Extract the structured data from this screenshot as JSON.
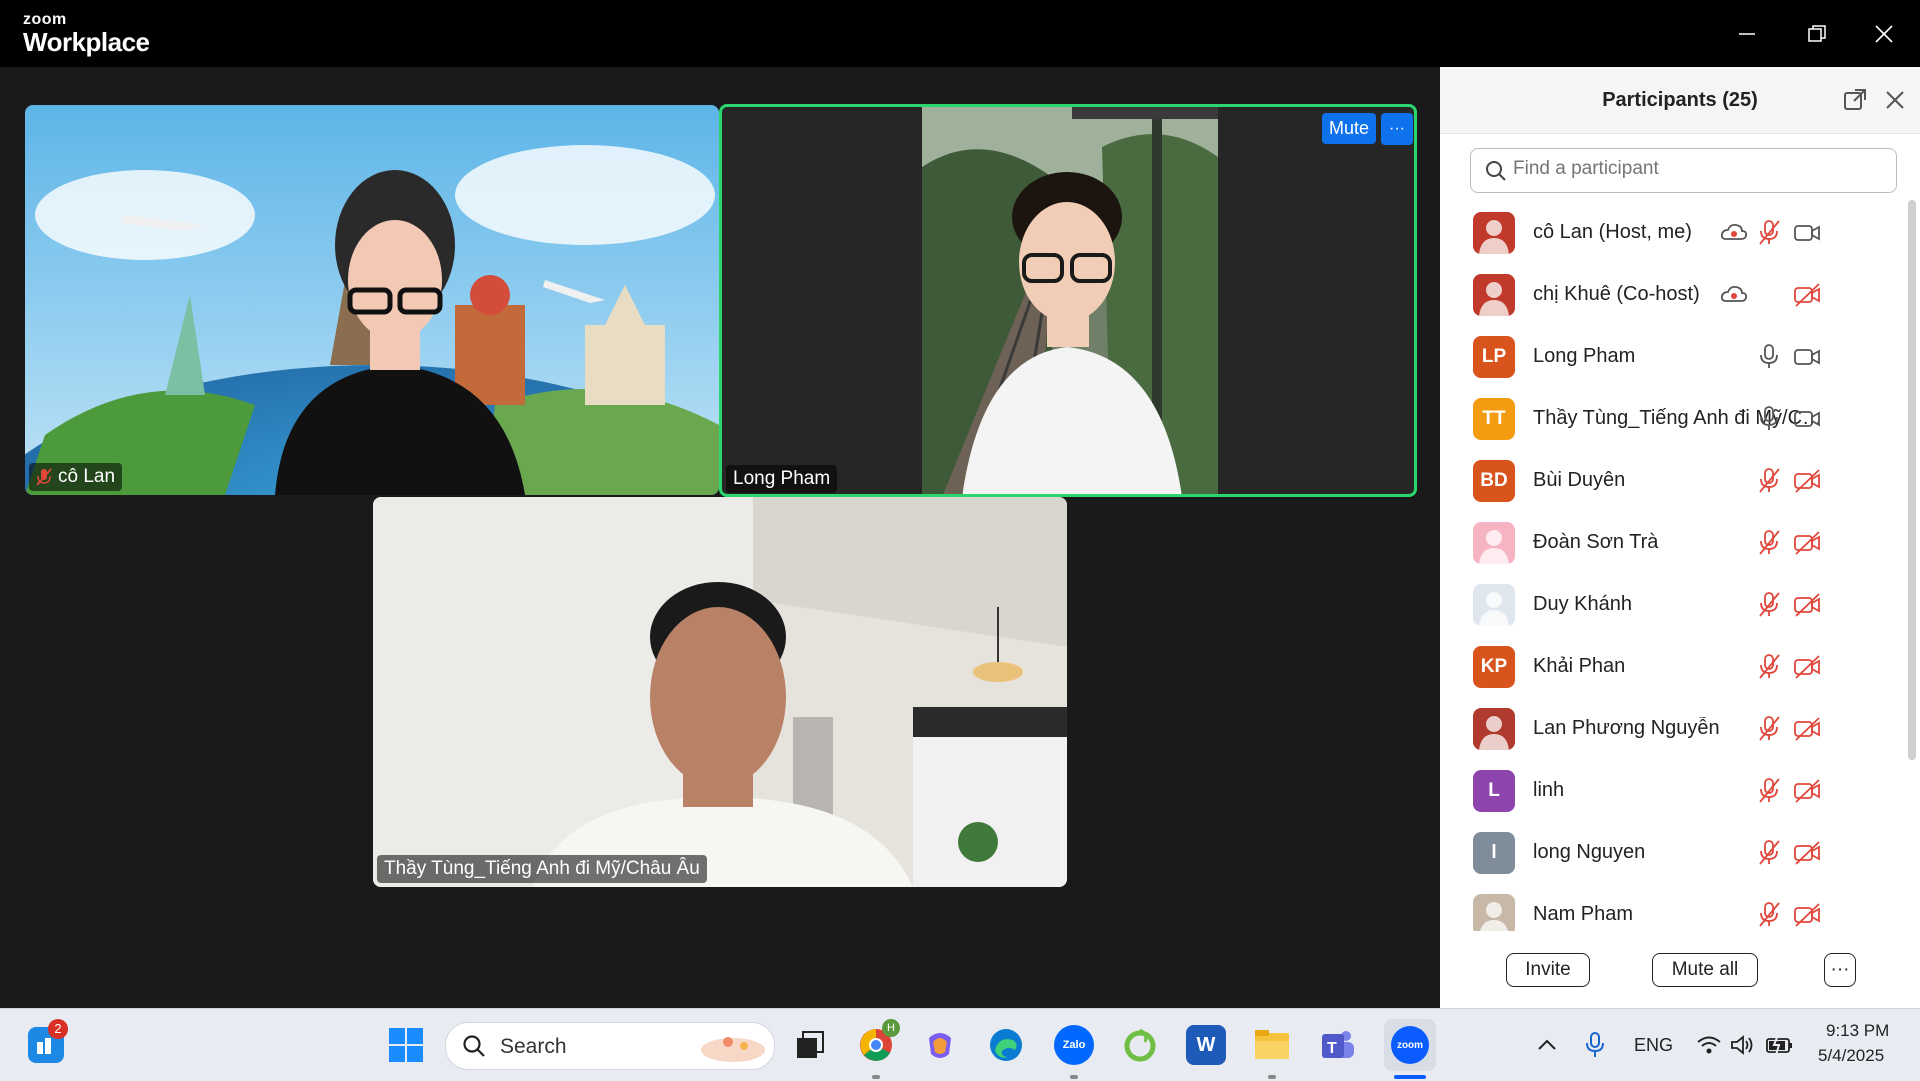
{
  "app": {
    "brand_small": "zoom",
    "brand_big": "Workplace"
  },
  "window_controls": {
    "minimize": "minimize-icon",
    "restore": "restore-icon",
    "close": "close-icon"
  },
  "videos": [
    {
      "name": "cô Lan",
      "muted": true
    },
    {
      "name": "Long Pham",
      "active_speaker": true,
      "mute_label": "Mute",
      "more_label": "···"
    },
    {
      "name": "Thầy Tùng_Tiếng Anh đi Mỹ/Châu Âu"
    }
  ],
  "participants_panel": {
    "title": "Participants (25)",
    "search_placeholder": "Find a participant",
    "participants": [
      {
        "name": "cô Lan (Host, me)",
        "avatar_type": "photo",
        "avatar_color": "#c0392b",
        "cloud": true,
        "mic": "muted",
        "video": "on"
      },
      {
        "name": "chị Khuê (Co-host)",
        "avatar_type": "photo",
        "avatar_color": "#c0392b",
        "cloud": true,
        "mic": "none",
        "video": "off"
      },
      {
        "name": "Long Pham",
        "initials": "LP",
        "avatar_color": "#d8541c",
        "mic": "on",
        "video": "on"
      },
      {
        "name": "Thầy Tùng_Tiếng Anh đi Mỹ/Ch...",
        "initials": "TT",
        "avatar_color": "#f39c12",
        "mic": "on",
        "video": "on"
      },
      {
        "name": "Bùi Duyên",
        "initials": "BD",
        "avatar_color": "#d8541c",
        "mic": "muted",
        "video": "off"
      },
      {
        "name": "Đoàn Sơn Trà",
        "avatar_type": "photo",
        "avatar_color": "#f6b3c1",
        "mic": "muted",
        "video": "off"
      },
      {
        "name": "Duy Khánh",
        "avatar_type": "photo",
        "avatar_color": "#dfe6ee",
        "mic": "muted",
        "video": "off"
      },
      {
        "name": "Khải Phan",
        "initials": "KP",
        "avatar_color": "#d8541c",
        "mic": "muted",
        "video": "off"
      },
      {
        "name": "Lan Phương Nguyễn",
        "avatar_type": "photo",
        "avatar_color": "#b03a2e",
        "mic": "muted",
        "video": "off"
      },
      {
        "name": "linh",
        "initials": "L",
        "avatar_color": "#8e44ad",
        "mic": "muted",
        "video": "off"
      },
      {
        "name": "long Nguyen",
        "initials": "l",
        "avatar_color": "#7f8c9a",
        "mic": "muted",
        "video": "off"
      },
      {
        "name": "Nam Pham",
        "avatar_type": "photo",
        "avatar_color": "#c7b8a8",
        "mic": "muted",
        "video": "off"
      }
    ],
    "buttons": {
      "invite": "Invite",
      "mute_all": "Mute all",
      "more": "···"
    }
  },
  "taskbar": {
    "widgets_badge": "2",
    "search_label": "Search",
    "apps": [
      "start-icon",
      "task-view-icon",
      "chrome-icon",
      "copilot-icon",
      "edge-icon",
      "zalo-icon",
      "coccoc-icon",
      "word-icon",
      "file-explorer-icon",
      "teams-icon",
      "zoom-icon"
    ],
    "chrome_badge": "H",
    "zalo_label": "Zalo",
    "zoom_label": "zoom",
    "word_label": "W",
    "language": "ENG",
    "time": "9:13 PM",
    "date": "5/4/2025"
  }
}
